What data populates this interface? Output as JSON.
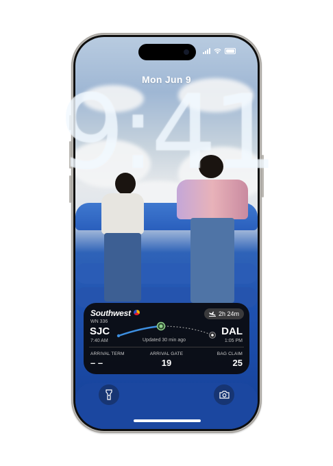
{
  "lock_screen": {
    "date": "Mon Jun 9",
    "time": "9:41"
  },
  "widget": {
    "airline": "Southwest",
    "flight": "WN 336",
    "duration": "2h 24m",
    "origin": "SJC",
    "destination": "DAL",
    "departure_time": "7:40 AM",
    "arrival_time": "1:05 PM",
    "updated": "Updated 30 min ago",
    "progress": 0.48,
    "arrival_term_label": "ARRIVAL TERM",
    "arrival_term_value": "– –",
    "arrival_gate_label": "ARRIVAL GATE",
    "arrival_gate_value": "19",
    "bag_claim_label": "BAG CLAIM",
    "bag_claim_value": "25"
  },
  "colors": {
    "route_active": "#3d8fe0",
    "plane_marker": "#8fd18a",
    "widget_bg": "#0a0a0c"
  },
  "icons": {
    "flashlight": "flashlight-icon",
    "camera": "camera-icon",
    "signal": "cellular-signal-icon",
    "wifi": "wifi-icon",
    "battery": "battery-icon"
  }
}
